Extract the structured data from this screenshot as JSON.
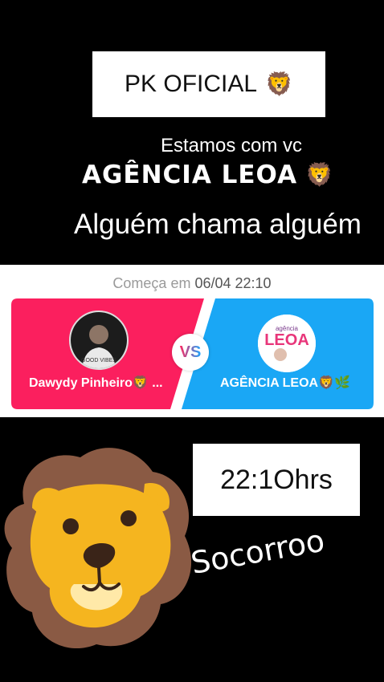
{
  "header": {
    "title": "PK OFICIAL",
    "title_emoji": "🦁",
    "subtitle": "Estamos com vc",
    "agency": "AGÊNCIA LEOA",
    "agency_emoji": "🦁",
    "call_to_action": "Alguém chama alguém"
  },
  "pk_battle": {
    "starts_label": "Começa em",
    "starts_value": "06/04 22:10",
    "vs_label": "VS",
    "left": {
      "name": "Dawydy Pinheiro🦁 ...",
      "avatar_text": "GOOD VIBES",
      "color": "#fb1f5e"
    },
    "right": {
      "name": "AGÊNCIA LEOA🦁🌿",
      "logo_top": "agência",
      "logo_main": "LEOA",
      "color": "#1aa7f5"
    }
  },
  "time_box": {
    "text": "22:1Ohrs"
  },
  "caption": "Socorroo",
  "colors": {
    "lion_mane": "#8a5a44",
    "lion_face": "#f5b51f",
    "background": "#000000"
  },
  "icons": [
    "lion-icon",
    "lion-sticker"
  ]
}
